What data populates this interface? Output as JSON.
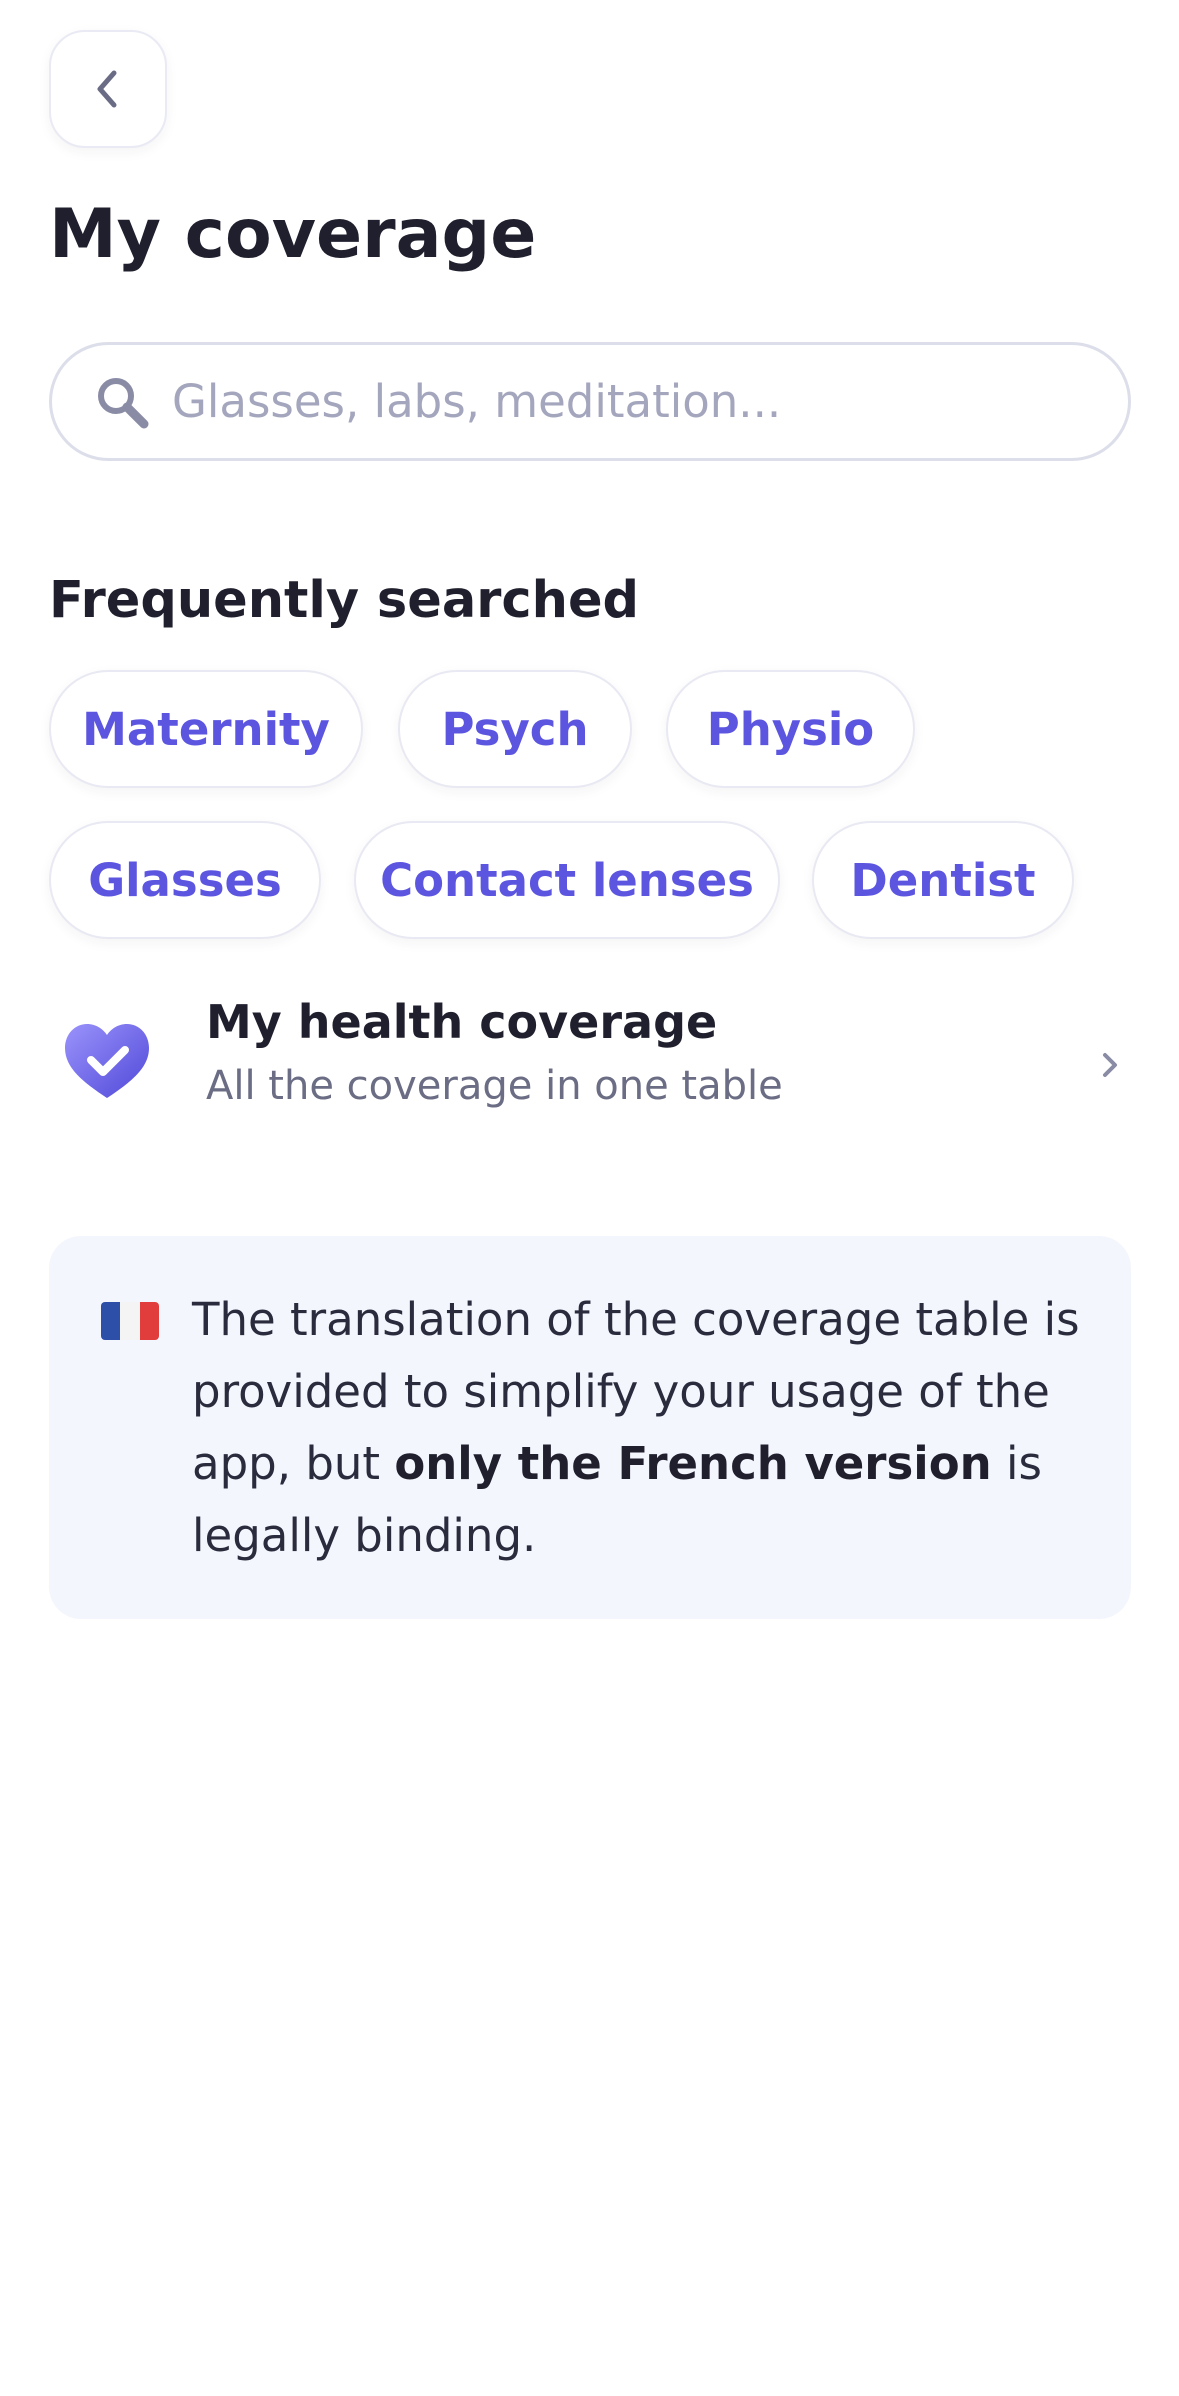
{
  "header": {
    "back_icon": "chevron-left-icon",
    "title": "My coverage"
  },
  "search": {
    "icon": "search-icon",
    "placeholder": "Glasses, labs, meditation...",
    "value": ""
  },
  "frequently_searched": {
    "title": "Frequently searched",
    "chips": [
      {
        "label": "Maternity"
      },
      {
        "label": "Psych"
      },
      {
        "label": "Physio"
      },
      {
        "label": "Glasses"
      },
      {
        "label": "Contact lenses"
      },
      {
        "label": "Dentist"
      }
    ]
  },
  "coverage_link": {
    "icon": "heart-check-icon",
    "title": "My health coverage",
    "subtitle": "All the coverage in one table",
    "chevron": "chevron-right-icon"
  },
  "notice": {
    "icon": "france-flag-icon",
    "text_before": "The translation of the coverage table is provided to simplify your usage of the app, but ",
    "text_bold": "only the French version",
    "text_after": " is legally binding."
  },
  "colors": {
    "accent": "#5c55e0",
    "text_primary": "#1f1f2e",
    "text_secondary": "#6b6d85",
    "placeholder": "#a4a6bd",
    "notice_bg": "#f4f6fd",
    "heart_light": "#8b84f7",
    "heart_dark": "#5a52de"
  }
}
